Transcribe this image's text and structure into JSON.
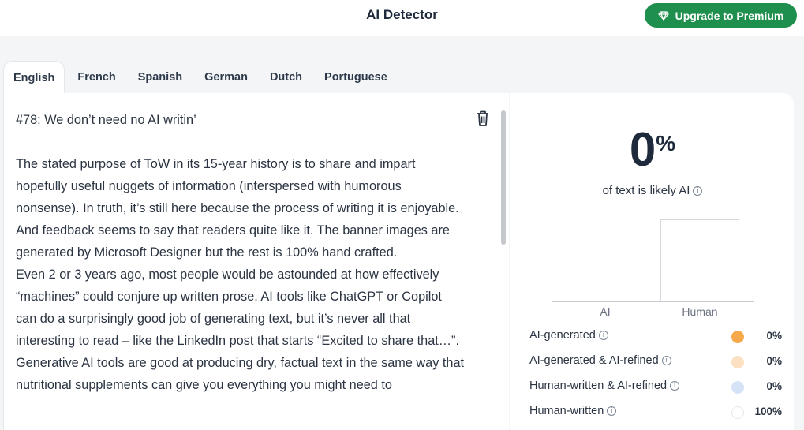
{
  "header": {
    "title": "AI Detector",
    "upgrade_label": "Upgrade to Premium"
  },
  "tabs": [
    {
      "label": "English",
      "active": true
    },
    {
      "label": "French",
      "active": false
    },
    {
      "label": "Spanish",
      "active": false
    },
    {
      "label": "German",
      "active": false
    },
    {
      "label": "Dutch",
      "active": false
    },
    {
      "label": "Portuguese",
      "active": false
    }
  ],
  "editor": {
    "paragraphs": [
      "#78: We don’t need no AI writin’",
      "",
      "The stated purpose of ToW in its 15-year history is to share and impart hopefully useful nuggets of information (interspersed with humorous nonsense). In truth, it’s still here because the process of writing it is enjoyable. And feedback seems to say that readers quite like it. The banner images are generated by Microsoft Designer but the rest is 100% hand crafted.",
      "Even 2 or 3 years ago, most people would be astounded at how effectively “machines” could conjure up written prose.  AI tools like ChatGPT or Copilot can do a surprisingly good job of generating text, but it’s never all that interesting to read – like the LinkedIn post that starts “Excited to share that…”.",
      "Generative AI tools are good at producing dry, factual text in the same way that nutritional supplements can give you everything you might need to"
    ]
  },
  "results": {
    "score": "0",
    "score_unit": "%",
    "likely_text": "of text is likely AI",
    "info_glyph": "i",
    "chart": {
      "categories": [
        "AI",
        "Human"
      ],
      "values": [
        0,
        100
      ],
      "ylim": [
        0,
        100
      ]
    },
    "legend": [
      {
        "label": "AI-generated",
        "color": "#f5a94b",
        "value": "0%"
      },
      {
        "label": "AI-generated & AI-refined",
        "color": "#fbe1c2",
        "value": "0%"
      },
      {
        "label": "Human-written & AI-refined",
        "color": "#d6e3f7",
        "value": "0%"
      },
      {
        "label": "Human-written",
        "color": "#ffffff",
        "value": "100%"
      }
    ]
  }
}
